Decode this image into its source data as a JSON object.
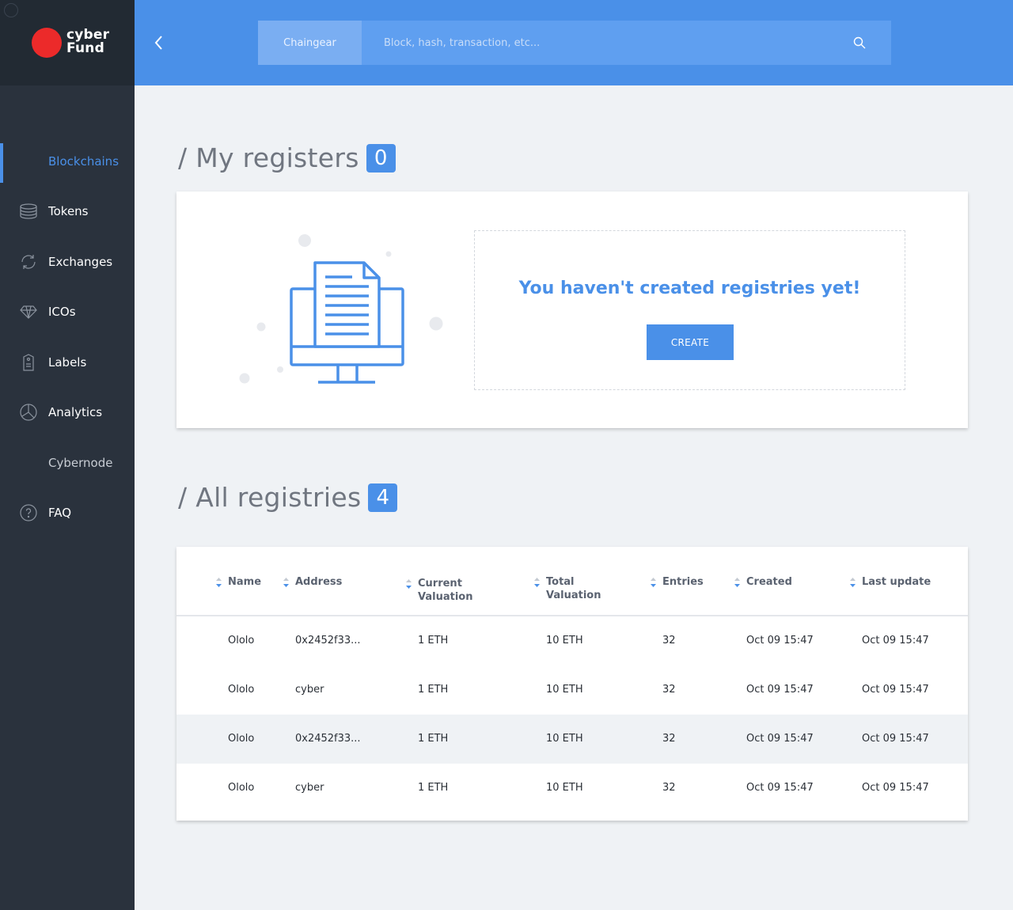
{
  "brand": {
    "line1": "cyber",
    "line2": "Fund"
  },
  "sidebar": {
    "items": [
      {
        "label": "Blockchains",
        "icon": "blockchains-icon",
        "state": "active"
      },
      {
        "label": "Tokens",
        "icon": "coins-stack-icon"
      },
      {
        "label": "Exchanges",
        "icon": "refresh-icon"
      },
      {
        "label": "ICOs",
        "icon": "diamond-icon"
      },
      {
        "label": "Labels",
        "icon": "tag-icon"
      },
      {
        "label": "Analytics",
        "icon": "pie-chart-icon"
      },
      {
        "label": "Cybernode",
        "icon": ""
      },
      {
        "label": "FAQ",
        "icon": "question-icon"
      }
    ]
  },
  "header": {
    "search_tab": "Chaingear",
    "search_placeholder": "Block, hash, transaction, etc..."
  },
  "my_registers": {
    "title": "/ My registers",
    "count": "0",
    "empty_message": "You haven't created registries yet!",
    "create_label": "CREATE"
  },
  "all_registries": {
    "title": "/ All registries",
    "count": "4",
    "columns": [
      "Name",
      "Address",
      "Current\nValuation",
      "Total\nValuation",
      "Entries",
      "Created",
      "Last update"
    ],
    "rows": [
      {
        "name": "Ololo",
        "address": "0x2452f33...",
        "current": "1 ETH",
        "total": "10 ETH",
        "entries": "32",
        "created": "Oct 09  15:47",
        "updated": "Oct 09  15:47"
      },
      {
        "name": "Ololo",
        "address": "cyber",
        "current": "1 ETH",
        "total": "10 ETH",
        "entries": "32",
        "created": "Oct 09  15:47",
        "updated": "Oct 09  15:47"
      },
      {
        "name": "Ololo",
        "address": "0x2452f33...",
        "current": "1 ETH",
        "total": "10 ETH",
        "entries": "32",
        "created": "Oct 09  15:47",
        "updated": "Oct 09  15:47"
      },
      {
        "name": "Ololo",
        "address": "cyber",
        "current": "1 ETH",
        "total": "10 ETH",
        "entries": "32",
        "created": "Oct 09  15:47",
        "updated": "Oct 09  15:47"
      }
    ]
  },
  "colors": {
    "accent": "#4a90e8",
    "sidebar": "#2a323d",
    "logo_dot": "#ec2a2a"
  }
}
